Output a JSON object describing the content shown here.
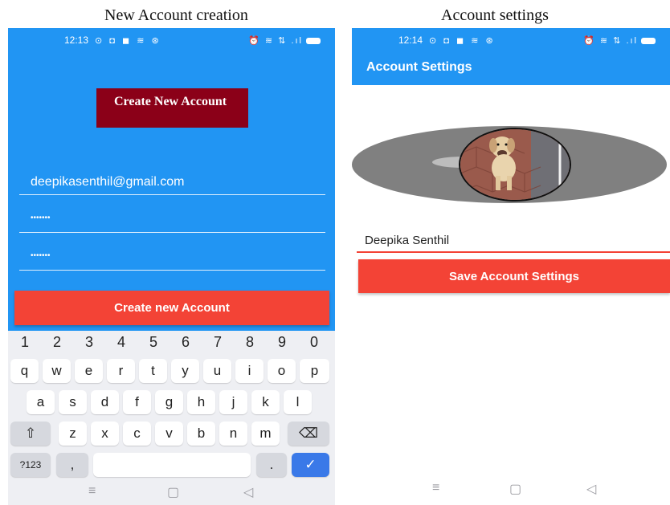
{
  "captions": {
    "left": "New Account creation",
    "right": "Account settings"
  },
  "left_phone": {
    "status": {
      "time": "12:13",
      "notifications": "⊙ ◘ ◼ ≋ ⊛",
      "system": "⏰ ≋ ⇅ .ıl"
    },
    "title": "Create New Account",
    "email_field": "deepikasenthil@gmail.com",
    "password_field": "•••••••",
    "confirm_field": "•••••••",
    "create_button": "Create new Account",
    "keyboard": {
      "numbers": [
        "1",
        "2",
        "3",
        "4",
        "5",
        "6",
        "7",
        "8",
        "9",
        "0"
      ],
      "row1": [
        "q",
        "w",
        "e",
        "r",
        "t",
        "y",
        "u",
        "i",
        "o",
        "p"
      ],
      "row2": [
        "a",
        "s",
        "d",
        "f",
        "g",
        "h",
        "j",
        "k",
        "l"
      ],
      "row3": [
        "z",
        "x",
        "c",
        "v",
        "b",
        "n",
        "m"
      ],
      "shift_icon": "⇧",
      "backspace_icon": "⌫",
      "symbols_key": "?123",
      "comma_key": ",",
      "period_key": ".",
      "enter_icon": "✓"
    },
    "nav": {
      "menu": "≡",
      "home": "▢",
      "back": "◁"
    }
  },
  "right_phone": {
    "status": {
      "time": "12:14",
      "notifications": "⊙ ◘ ◼ ≋ ⊛",
      "system": "⏰ ≋ ⇅ .ıl"
    },
    "appbar_title": "Account Settings",
    "name_field": "Deepika Senthil",
    "save_button": "Save Account Settings",
    "nav": {
      "menu": "≡",
      "home": "▢",
      "back": "◁"
    }
  },
  "colors": {
    "primary": "#2195f3",
    "accent_red": "#f34336",
    "title_box": "#8b0018"
  }
}
